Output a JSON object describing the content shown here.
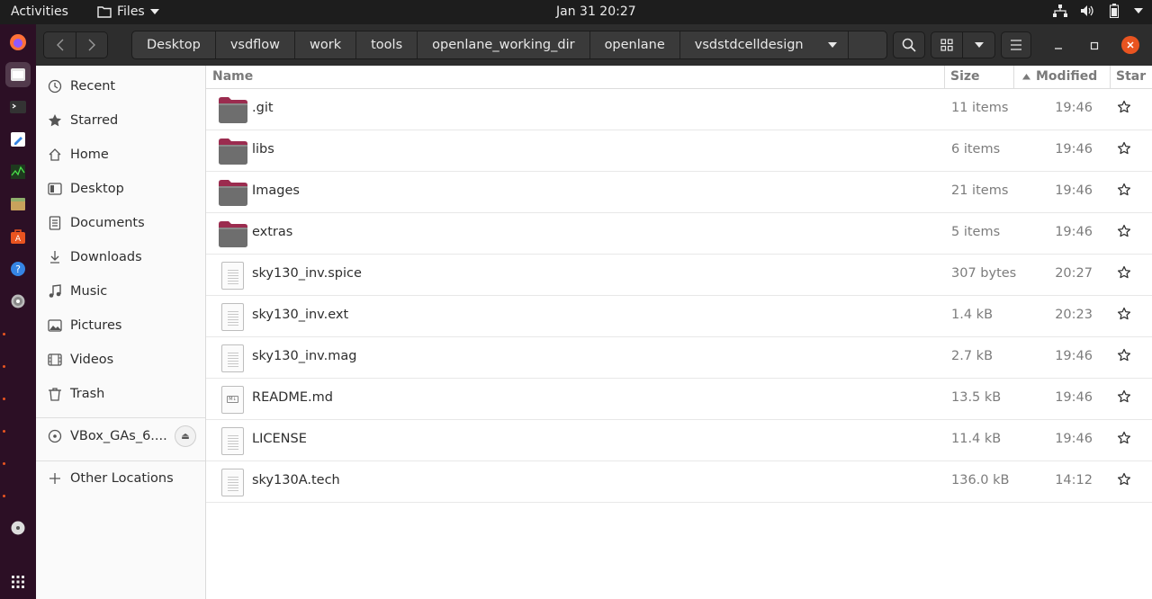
{
  "topbar": {
    "activities": "Activities",
    "app_name": "Files",
    "clock": "Jan 31  20:27"
  },
  "dock": {
    "items": [
      "firefox-icon",
      "files-icon",
      "terminal-icon",
      "text-editor-icon",
      "system-monitor-icon",
      "archive-icon",
      "software-icon",
      "help-icon",
      "disc-icon",
      "trash-disc-icon",
      "show-apps-icon"
    ]
  },
  "pathbar": {
    "crumbs": [
      "Desktop",
      "vsdflow",
      "work",
      "tools",
      "openlane_working_dir",
      "openlane",
      "vsdstdcelldesign"
    ]
  },
  "sidebar": {
    "items": [
      {
        "label": "Recent",
        "icon": "clock-icon"
      },
      {
        "label": "Starred",
        "icon": "star-icon"
      },
      {
        "label": "Home",
        "icon": "home-icon"
      },
      {
        "label": "Desktop",
        "icon": "desktop-icon"
      },
      {
        "label": "Documents",
        "icon": "documents-icon"
      },
      {
        "label": "Downloads",
        "icon": "downloads-icon"
      },
      {
        "label": "Music",
        "icon": "music-icon"
      },
      {
        "label": "Pictures",
        "icon": "pictures-icon"
      },
      {
        "label": "Videos",
        "icon": "videos-icon"
      },
      {
        "label": "Trash",
        "icon": "trash-icon"
      }
    ],
    "device": {
      "label": "VBox_GAs_6....",
      "icon": "disc-icon"
    },
    "other": {
      "label": "Other Locations",
      "icon": "plus-icon"
    }
  },
  "columns": {
    "name": "Name",
    "size": "Size",
    "modified": "Modified",
    "star": "Star"
  },
  "files": [
    {
      "name": ".git",
      "type": "folder",
      "size": "11 items",
      "modified": "19:46"
    },
    {
      "name": "libs",
      "type": "folder",
      "size": "6 items",
      "modified": "19:46"
    },
    {
      "name": "Images",
      "type": "folder",
      "size": "21 items",
      "modified": "19:46"
    },
    {
      "name": "extras",
      "type": "folder",
      "size": "5 items",
      "modified": "19:46"
    },
    {
      "name": "sky130_inv.spice",
      "type": "file",
      "size": "307 bytes",
      "modified": "20:27"
    },
    {
      "name": "sky130_inv.ext",
      "type": "file",
      "size": "1.4 kB",
      "modified": "20:23"
    },
    {
      "name": "sky130_inv.mag",
      "type": "file",
      "size": "2.7 kB",
      "modified": "19:46"
    },
    {
      "name": "README.md",
      "type": "markdown",
      "size": "13.5 kB",
      "modified": "19:46"
    },
    {
      "name": "LICENSE",
      "type": "file",
      "size": "11.4 kB",
      "modified": "19:46"
    },
    {
      "name": "sky130A.tech",
      "type": "file",
      "size": "136.0 kB",
      "modified": "14:12"
    }
  ],
  "colors": {
    "accent": "#e95420",
    "dock_bg": "#2c0f25",
    "folder_tab": "#9b2c4f",
    "folder_body": "#6e6e6e"
  }
}
